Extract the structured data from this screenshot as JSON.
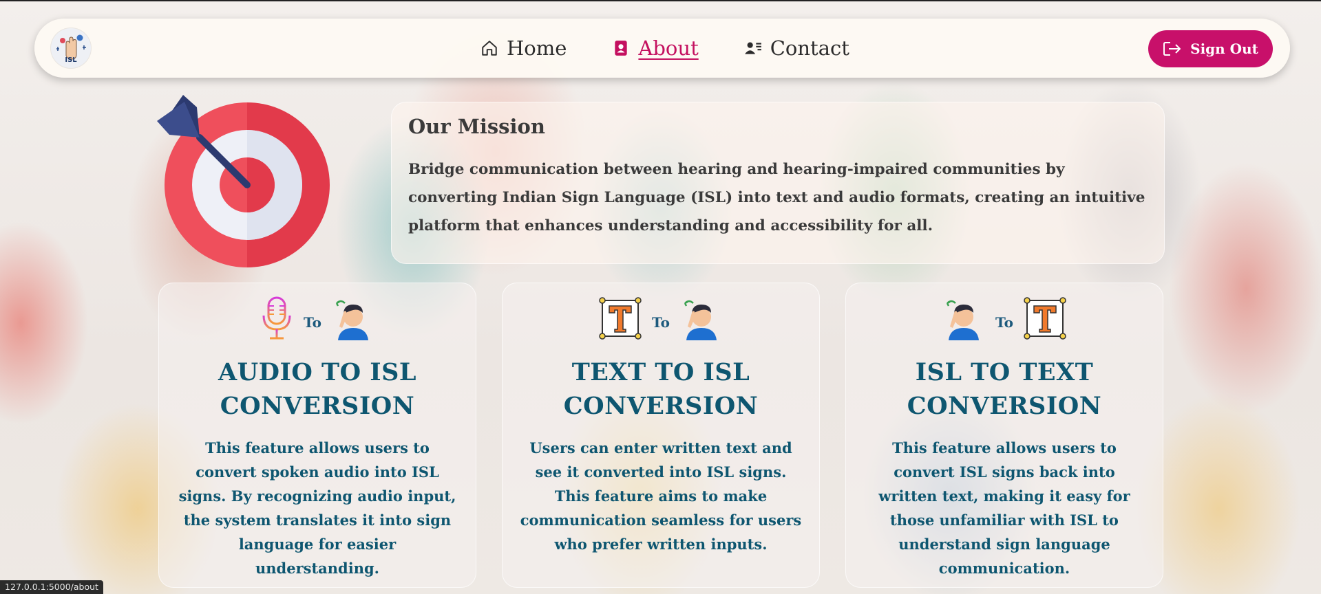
{
  "nav": {
    "logo_text": "ISL",
    "items": [
      {
        "label": "Home",
        "icon": "home-icon",
        "active": false
      },
      {
        "label": "About",
        "icon": "profile-icon",
        "active": true
      },
      {
        "label": "Contact",
        "icon": "contact-card-icon",
        "active": false
      }
    ],
    "sign_out_label": "Sign Out"
  },
  "mission": {
    "title": "Our Mission",
    "text": "Bridge communication between hearing and hearing-impaired communities by converting Indian Sign Language (ISL) into text and audio formats, creating an intuitive platform that enhances understanding and accessibility for all."
  },
  "features": [
    {
      "from_icon": "microphone-icon",
      "to_label": "To",
      "to_icon": "signing-person-icon",
      "title": "AUDIO TO ISL CONVERSION",
      "description": "This feature allows users to convert spoken audio into ISL signs. By recognizing audio input, the system translates it into sign language for easier understanding."
    },
    {
      "from_icon": "text-tool-icon",
      "to_label": "To",
      "to_icon": "signing-person-icon",
      "title": "TEXT TO ISL CONVERSION",
      "description": "Users can enter written text and see it converted into ISL signs. This feature aims to make communication seamless for users who prefer written inputs."
    },
    {
      "from_icon": "signing-person-icon",
      "to_label": "To",
      "to_icon": "text-tool-icon",
      "title": "ISL TO TEXT CONVERSION",
      "description": "This feature allows users to convert ISL signs back into written text, making it easy for those unfamiliar with ISL to understand sign language communication."
    }
  ],
  "status_bar": {
    "url": "127.0.0.1:5000/about"
  },
  "colors": {
    "accent": "#c8106a",
    "heading": "#0e5670",
    "target_red": "#e8434f"
  }
}
